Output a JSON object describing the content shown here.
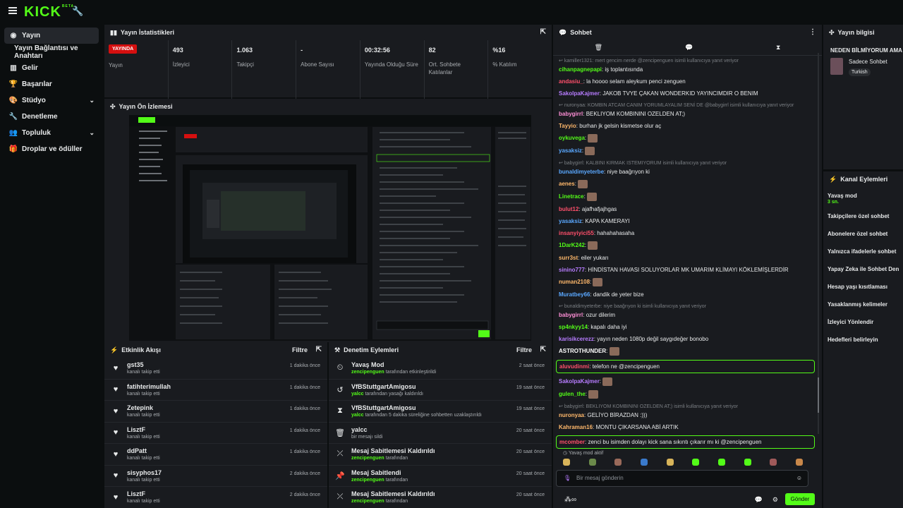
{
  "brand": {
    "logo": "KICK",
    "beta": "BETA"
  },
  "sidebar": {
    "items": [
      {
        "label": "Yayın",
        "icon": "broadcast-icon",
        "active": true
      },
      {
        "label": "Yayın Bağlantısı ve Anahtarı",
        "sub": true
      },
      {
        "label": "Gelir",
        "icon": "chart-icon"
      },
      {
        "label": "Başarılar",
        "icon": "trophy-icon"
      },
      {
        "label": "Stüdyo",
        "icon": "palette-icon",
        "expand": true
      },
      {
        "label": "Denetleme",
        "icon": "wrench-icon"
      },
      {
        "label": "Topluluk",
        "icon": "users-icon",
        "expand": true
      },
      {
        "label": "Droplar ve ödüller",
        "icon": "gift-icon"
      }
    ]
  },
  "stats": {
    "title": "Yayın İstatistikleri",
    "live_badge": "YAYINDA",
    "items": [
      {
        "value": "",
        "label": "Yayın"
      },
      {
        "value": "493",
        "label": "İzleyici"
      },
      {
        "value": "1.063",
        "label": "Takipçi"
      },
      {
        "value": "-",
        "label": "Abone Sayısı"
      },
      {
        "value": "00:32:56",
        "label": "Yayında Olduğu Süre"
      },
      {
        "value": "82",
        "label": "Ort. Sohbete Katılanlar"
      },
      {
        "value": "%16",
        "label": "% Katılım"
      }
    ]
  },
  "preview": {
    "title": "Yayın Ön İzlemesi"
  },
  "activity": {
    "title": "Etkinlik Akışı",
    "filter": "Filtre",
    "rows": [
      {
        "name": "gst35",
        "sub": "kanalı takip etti",
        "time": "1 dakika önce"
      },
      {
        "name": "fatihterimullah",
        "sub": "kanalı takip etti",
        "time": "1 dakika önce"
      },
      {
        "name": "Zetepink",
        "sub": "kanalı takip etti",
        "time": "1 dakika önce"
      },
      {
        "name": "LisztF",
        "sub": "kanalı takip etti",
        "time": "1 dakika önce"
      },
      {
        "name": "ddPatt",
        "sub": "kanalı takip etti",
        "time": "1 dakika önce"
      },
      {
        "name": "sisyphos17",
        "sub": "kanalı takip etti",
        "time": "2 dakika önce"
      },
      {
        "name": "LisztF",
        "sub": "kanalı takip etti",
        "time": "2 dakika önce"
      }
    ]
  },
  "moderation": {
    "title": "Denetim Eylemleri",
    "filter": "Filtre",
    "rows": [
      {
        "icon": "slow-mode-icon",
        "name": "Yavaş Mod",
        "actor": "zencipenguen",
        "sub": "tarafından etkinleştirildi",
        "time": "2 saat önce"
      },
      {
        "icon": "undo-icon",
        "name": "VfBStuttgartAmigosu",
        "actor": "yalcc",
        "sub": "tarafından yasağı kaldırıldı",
        "time": "19 saat önce"
      },
      {
        "icon": "hourglass-icon",
        "name": "VfBStuttgartAmigosu",
        "actor": "yalcc",
        "sub": "tarafından 5 dakika süreliğine sohbetten uzaklaştırıldı",
        "time": "19 saat önce"
      },
      {
        "icon": "trash-icon",
        "name": "yalcc",
        "actor": "",
        "sub": "bir mesajı sildi",
        "time": "20 saat önce"
      },
      {
        "icon": "unpin-icon",
        "name": "Mesaj Sabitlemesi Kaldırıldı",
        "actor": "zencipenguen",
        "sub": "tarafından",
        "time": "20 saat önce"
      },
      {
        "icon": "pin-icon",
        "name": "Mesaj Sabitlendi",
        "actor": "zencipenguen",
        "sub": "tarafından",
        "time": "20 saat önce"
      },
      {
        "icon": "unpin-icon",
        "name": "Mesaj Sabitlemesi Kaldırıldı",
        "actor": "zencipenguen",
        "sub": "tarafından",
        "time": "20 saat önce"
      }
    ]
  },
  "chat": {
    "title": "Sohbet",
    "messages": [
      {
        "reply": "kamiller1321: mert gencim nerde @zencipenguen isimli kullanıcıya yanıt veriyor"
      },
      {
        "user": "cihanpagnepapi",
        "color": "#53fc18",
        "text": "iş toplantısında"
      },
      {
        "user": "andasiu_",
        "color": "#ff4f6b",
        "text": "la hoooo selam aleykum penci zenguen"
      },
      {
        "user": "SakolpaKajmer",
        "color": "#b77cff",
        "text": "JAKOB TVYE ÇAKAN WONDERKID YAYINCIMDIR O BENIM"
      },
      {
        "reply": "nuronyaa: KOMBIN ATCAM CANIM YORUMLAYALIM SENİ DE @babygirrl isimli kullanıcıya yanıt veriyor"
      },
      {
        "user": "babygirrl",
        "color": "#ff8fd6",
        "text": "BEKLIYOM KOMBININI OZELDEN AT;)"
      },
      {
        "user": "Tayyio",
        "color": "#ffb86b",
        "text": "burhan jk gelsin kismetse olur aç"
      },
      {
        "user": "oykuvega",
        "color": "#53fc18",
        "text": "",
        "emote": true
      },
      {
        "user": "yasaksiz",
        "color": "#5aa8ff",
        "text": "",
        "emote": true
      },
      {
        "reply": "babygirrl: KALBINI KIRMAK ISTEMIYORUM isimli kullanıcıya yanıt veriyor"
      },
      {
        "user": "bunaldimyeterbe",
        "color": "#5aa8ff",
        "text": "niye baağrıyon ki"
      },
      {
        "user": "aenes",
        "color": "#ffb86b",
        "text": "",
        "emote": true
      },
      {
        "user": "Linetrace",
        "color": "#53fc18",
        "text": "",
        "emote": true
      },
      {
        "user": "bulut12",
        "color": "#ff4f6b",
        "text": "ajafhafjajhgas"
      },
      {
        "user": "yasaksiz",
        "color": "#5aa8ff",
        "text": "KAPA KAMERAYI"
      },
      {
        "user": "insanyiyici55",
        "color": "#ff4f6b",
        "text": "hahahahasaha"
      },
      {
        "user": "1DarK242",
        "color": "#53fc18",
        "text": "",
        "emote": true
      },
      {
        "user": "surr3st",
        "color": "#ffb86b",
        "text": "eiler yukarı"
      },
      {
        "user": "sinino777",
        "color": "#b77cff",
        "text": "HİNDİSTAN HAVASI SOLUYORLAR MK UMARIM KLİMAYI KÖKLEMİŞLERDİR"
      },
      {
        "user": "numan2108",
        "color": "#ffb86b",
        "text": "",
        "emote": true
      },
      {
        "user": "Muratbey66",
        "color": "#5aa8ff",
        "text": "dandik de yeter bize"
      },
      {
        "reply": "bunaldimyeterbe: niye baağrıyon ki isimli kullanıcıya yanıt veriyor"
      },
      {
        "user": "babygirrl",
        "color": "#ff8fd6",
        "text": "ozur dilerim"
      },
      {
        "user": "sp4nkyy14",
        "color": "#53fc18",
        "text": "kapalı daha iyi"
      },
      {
        "user": "karisikcerezz",
        "color": "#b77cff",
        "text": "yayın neden 1080p değil saygıdeğer bonobo"
      },
      {
        "user": "ASTROTHUNDER",
        "color": "#ffffff",
        "text": "",
        "emote": true
      },
      {
        "user": "aluvudinmi",
        "color": "#ff4f6b",
        "text": "telefon ne @zencipenguen",
        "highlight": true
      },
      {
        "user": "SakolpaKajmer",
        "color": "#b77cff",
        "text": "",
        "emote": true
      },
      {
        "user": "gulen_the",
        "color": "#53fc18",
        "text": "",
        "emote": true
      },
      {
        "reply": "babygirrl: BEKLIYOM KOMBININI OZELDEN AT;) isimli kullanıcıya yanıt veriyor"
      },
      {
        "user": "nuronyaa",
        "color": "#ffb86b",
        "text": "GELİYO BİRAZDAN :)))"
      },
      {
        "user": "Kahraman16",
        "color": "#ffb86b",
        "text": "MONTU ÇIKARSANA ABİ ARTIK"
      },
      {
        "user": "mcomber",
        "color": "#ff4f6b",
        "text": "zenci bu isimden dolayı kick sana sıkıntı çıkarır mı ki @zencipenguen",
        "highlight": true
      }
    ],
    "slow_mode_notice": "Yavaş mod aktif",
    "input_placeholder": "Bir mesaj gönderin",
    "send_label": "Gönder"
  },
  "stream_info": {
    "title": "Yayın bilgisi",
    "stream_title": "NEDEN BİLMİYORUM AMA",
    "category": "Sadece Sohbet",
    "tag": "Turkish"
  },
  "channel_actions": {
    "title": "Kanal Eylemleri",
    "items": [
      {
        "label": "Yavaş mod",
        "sub": "3 sn."
      },
      {
        "label": "Takipçilere özel sohbet"
      },
      {
        "label": "Abonelere özel sohbet"
      },
      {
        "label": "Yalnızca ifadelerle sohbet"
      },
      {
        "label": "Yapay Zeka ile Sohbet Dene"
      },
      {
        "label": "Hesap yaşı kısıtlaması"
      },
      {
        "label": "Yasaklanmış kelimeler"
      },
      {
        "label": "İzleyici Yönlendir"
      },
      {
        "label": "Hedefleri belirleyin"
      }
    ]
  },
  "colors": {
    "accent": "#53fc18",
    "panel": "#191b1f",
    "bg": "#0b0e0f",
    "live": "#d50f0f"
  }
}
